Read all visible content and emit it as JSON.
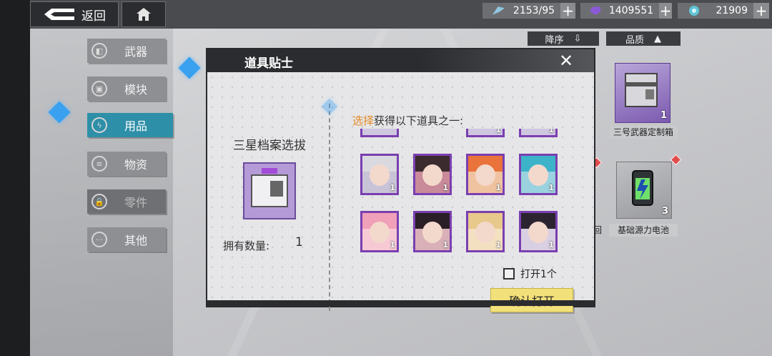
{
  "topbar": {
    "back_label": "返回",
    "resources": [
      {
        "icon": "stamina-icon",
        "value": "2153/95",
        "color": "#7fb7d6"
      },
      {
        "icon": "crystal-icon",
        "value": "1409551",
        "color": "#8a5ad6"
      },
      {
        "icon": "gem-icon",
        "value": "21909",
        "color": "#6fd3e0"
      }
    ]
  },
  "sort": {
    "order_label": "降序",
    "quality_label": "品质"
  },
  "sidebar": {
    "items": [
      {
        "label": "武器",
        "icon": "gun-icon"
      },
      {
        "label": "模块",
        "icon": "module-icon"
      },
      {
        "label": "用品",
        "icon": "lightning-icon",
        "active": true
      },
      {
        "label": "物资",
        "icon": "supplies-icon"
      },
      {
        "label": "零件",
        "icon": "parts-icon",
        "locked": true
      },
      {
        "label": "其他",
        "icon": "ellipsis-icon"
      }
    ]
  },
  "inventory": {
    "items": [
      {
        "label": "三号武器定制箱",
        "count": "1"
      },
      {
        "label": "基础源力电池",
        "count": "3"
      }
    ],
    "partial_label": "回"
  },
  "modal": {
    "title": "道具贴士",
    "box_name": "三星档案选拔",
    "own_label": "拥有数量:",
    "own_value": "1",
    "pick_title_highlight": "选择",
    "pick_title_rest": "获得以下道具之一:",
    "portraits": [
      {
        "count": "1",
        "hair": "#d9d9df",
        "bg": "#c9c3d8"
      },
      {
        "count": "1",
        "hair": "#3b2a2e",
        "bg": "#c98a9a"
      },
      {
        "count": "1",
        "hair": "#e9733a",
        "bg": "#f0c3a0"
      },
      {
        "count": "1",
        "hair": "#3cb3c9",
        "bg": "#9ad2e0"
      },
      {
        "count": "1",
        "hair": "#f0a0b8",
        "bg": "#f7c9d4"
      },
      {
        "count": "1",
        "hair": "#2a1f26",
        "bg": "#d9b0b8"
      },
      {
        "count": "1",
        "hair": "#e8c98c",
        "bg": "#f3e0c0"
      },
      {
        "count": "1",
        "hair": "#2b2430",
        "bg": "#d9cfe3"
      }
    ],
    "partial_counts": [
      "1",
      "1"
    ],
    "open_one_label": "打开1个",
    "confirm_label": "确认打开"
  }
}
